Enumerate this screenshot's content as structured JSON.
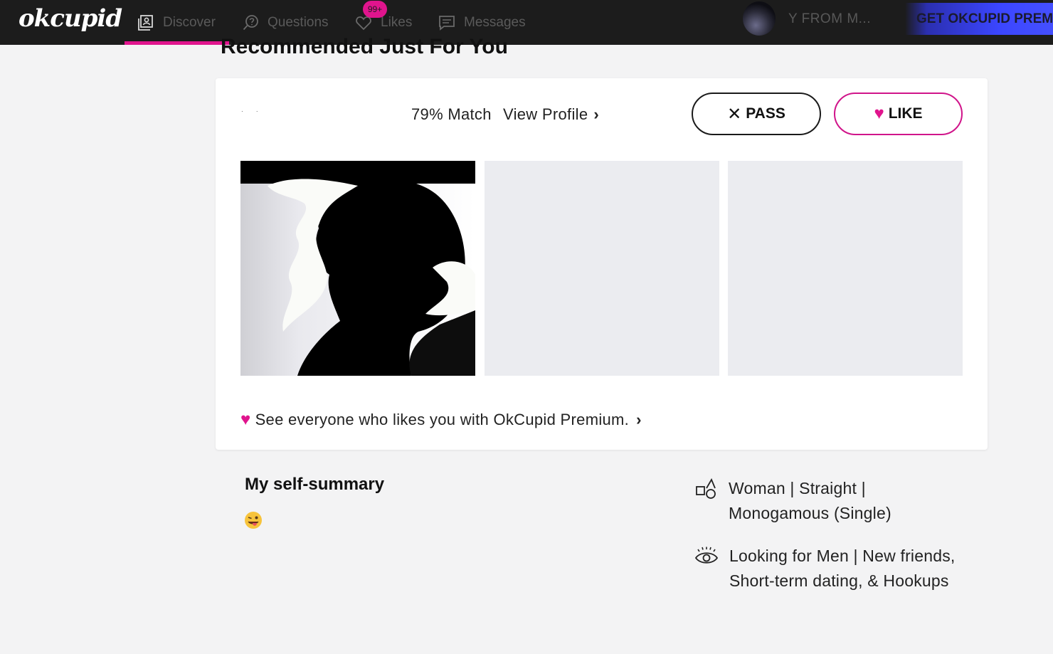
{
  "app": {
    "logo": "okcupid"
  },
  "nav": {
    "items": [
      {
        "label": "Discover",
        "icon": "discover-icon",
        "active": true
      },
      {
        "label": "Questions",
        "icon": "questions-icon"
      },
      {
        "label": "Likes",
        "icon": "heart-outline-icon",
        "badge": "99+"
      },
      {
        "label": "Messages",
        "icon": "chat-icon"
      }
    ],
    "user_name": "Y FROM M...",
    "premium_label": "GET OKCUPID PREMI"
  },
  "colors": {
    "accent": "#e0148d",
    "topbar": "#1c1c1c",
    "premium_blue": "#3b46ff",
    "photo_placeholder": "#ebecf0"
  },
  "heading": "Recommended Just For You",
  "card": {
    "match": "79% Match",
    "view_profile": "View Profile",
    "pass_label": "PASS",
    "like_label": "LIKE",
    "premium_promo": "See everyone who likes you with OkCupid Premium."
  },
  "profile": {
    "summary_title": "My self-summary",
    "summary_emoji": "😜",
    "details": [
      {
        "icon": "gender-shapes-icon",
        "text": "Woman | Straight | Monogamous (Single)"
      },
      {
        "icon": "eye-icon",
        "text": "Looking for Men | New friends, Short-term dating, & Hookups"
      }
    ]
  }
}
